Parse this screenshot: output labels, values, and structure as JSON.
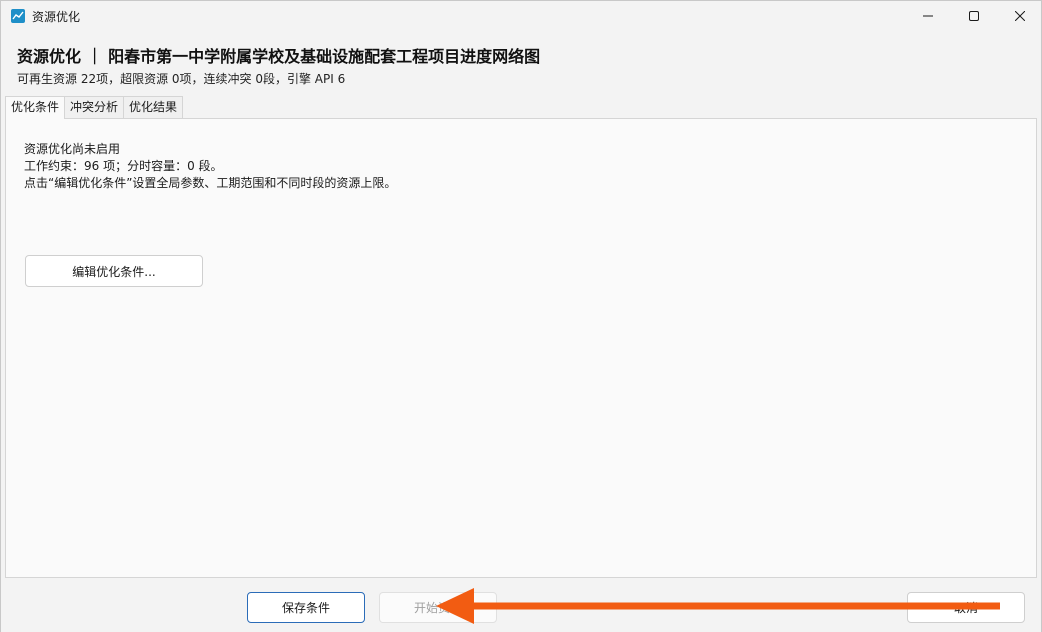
{
  "window": {
    "title": "资源优化",
    "controls": {
      "minimize": "minimize-icon",
      "maximize": "maximize-icon",
      "close": "close-icon"
    }
  },
  "header": {
    "title": "资源优化 ｜ 阳春市第一中学附属学校及基础设施配套工程项目进度网络图",
    "summary": "可再生资源 22项，超限资源 0项，连续冲突 0段，引擎 API 6"
  },
  "tabs": [
    {
      "label": "优化条件",
      "active": true
    },
    {
      "label": "冲突分析",
      "active": false
    },
    {
      "label": "优化结果",
      "active": false
    }
  ],
  "content": {
    "status_lines": [
      "资源优化尚未启用",
      "工作约束：96 项；分时容量：0 段。",
      "点击“编辑优化条件”设置全局参数、工期范围和不同时段的资源上限。"
    ],
    "edit_button": "编辑优化条件..."
  },
  "footer": {
    "save_button": "保存条件",
    "start_button": "开始资源",
    "cancel_button": "取消"
  },
  "colors": {
    "accent": "#2b6cb8",
    "annotation_arrow": "#f25c12"
  }
}
